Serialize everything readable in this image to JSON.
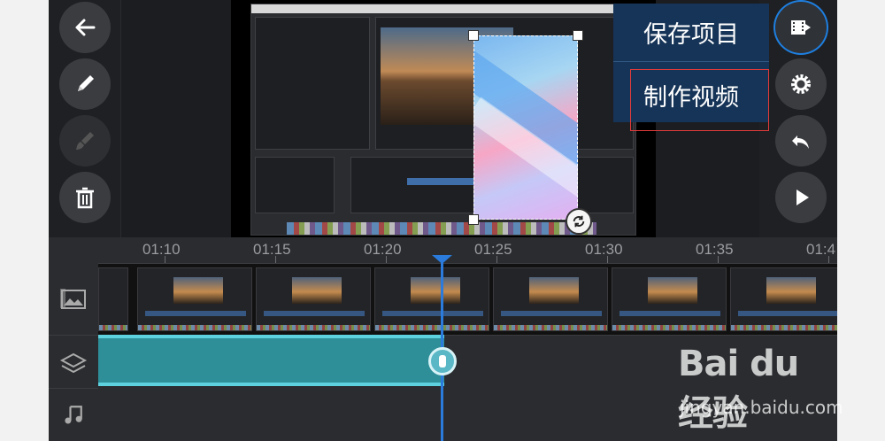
{
  "menu": {
    "save_project": "保存项目",
    "make_video": "制作视频"
  },
  "toolbar_left": {
    "back_icon": "arrow-left-icon",
    "edit_icon": "pencil-icon",
    "brush_icon": "brush-icon",
    "delete_icon": "trash-icon"
  },
  "toolbar_right": {
    "export_icon": "film-export-icon",
    "settings_icon": "gear-icon",
    "undo_icon": "undo-icon",
    "play_icon": "play-icon"
  },
  "ruler": {
    "labels": [
      "01:10",
      "01:15",
      "01:20",
      "01:25",
      "01:30",
      "01:35",
      "01:4"
    ]
  },
  "tracks": {
    "video_icon": "video-track-icon",
    "layer_icon": "layers-icon",
    "audio_icon": "music-note-icon"
  },
  "colors": {
    "accent": "#2a7bdc",
    "overlay_track": "#2e8f99",
    "menu_bg": "#163457",
    "highlight": "#e23b3b"
  },
  "watermark": {
    "logo": "Bai du 经验",
    "url": "jingyan.baidu.com"
  }
}
